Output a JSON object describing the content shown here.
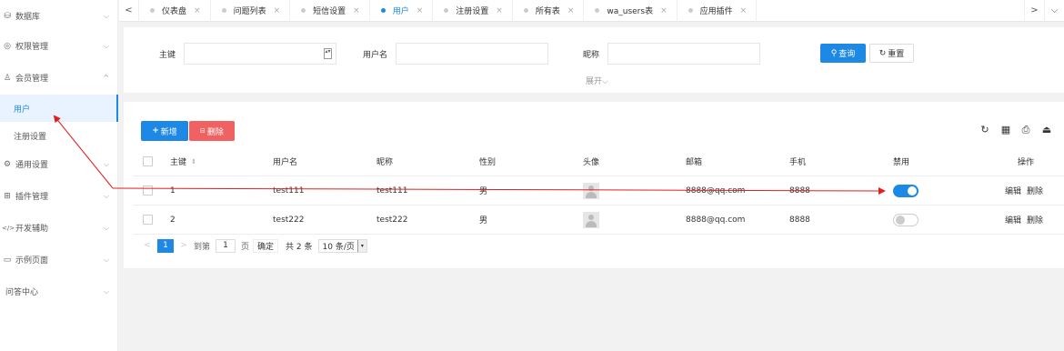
{
  "sidebar": {
    "items": [
      {
        "label": "数据库",
        "icon": "database-icon",
        "glyph": "⛁",
        "arrow": "⌵"
      },
      {
        "label": "权限管理",
        "icon": "shield-icon",
        "glyph": "◎",
        "arrow": "⌵"
      },
      {
        "label": "会员管理",
        "icon": "user-icon",
        "glyph": "♙",
        "arrow": "^"
      },
      {
        "label": "通用设置",
        "icon": "gear-icon",
        "glyph": "⚙",
        "arrow": "⌵"
      },
      {
        "label": "插件管理",
        "icon": "plugin-icon",
        "glyph": "⊞",
        "arrow": "⌵"
      },
      {
        "label": "开发辅助",
        "icon": "code-icon",
        "glyph": "</>",
        "arrow": "⌵"
      },
      {
        "label": "示例页面",
        "icon": "page-icon",
        "glyph": "▭",
        "arrow": "⌵"
      },
      {
        "label": "问答中心",
        "icon": "",
        "glyph": "",
        "arrow": "⌵"
      }
    ],
    "subitems": [
      "用户",
      "注册设置"
    ]
  },
  "tabs": [
    {
      "label": "仪表盘",
      "close": "×",
      "active": false
    },
    {
      "label": "问题列表",
      "close": "×",
      "active": false
    },
    {
      "label": "短信设置",
      "close": "×",
      "active": false
    },
    {
      "label": "用户",
      "close": "×",
      "active": true
    },
    {
      "label": "注册设置",
      "close": "×",
      "active": false
    },
    {
      "label": "所有表",
      "close": "×",
      "active": false
    },
    {
      "label": "wa_users表",
      "close": "×",
      "active": false
    },
    {
      "label": "应用插件",
      "close": "×",
      "active": false
    }
  ],
  "tab_nav": {
    "left": "<",
    "right": ">",
    "more": "⌵"
  },
  "search": {
    "pk_label": "主键",
    "pk_value": "",
    "spinner": "▴▾",
    "username_label": "用户名",
    "username_value": "",
    "nickname_label": "昵称",
    "nickname_value": "",
    "query_label": "查询",
    "query_icon": "⚲",
    "reset_label": "重置",
    "reset_icon": "↻",
    "expand_label": "展开",
    "expand_icon": "⌵"
  },
  "toolbar": {
    "add_label": "新增",
    "add_icon": "+",
    "delete_label": "删除",
    "delete_icon": "⊟",
    "tools": [
      {
        "name": "refresh-icon",
        "glyph": "↻"
      },
      {
        "name": "columns-icon",
        "glyph": "▦"
      },
      {
        "name": "print-icon",
        "glyph": "⎙"
      },
      {
        "name": "export-icon",
        "glyph": "⏏"
      }
    ]
  },
  "table": {
    "headers": [
      "主键",
      "用户名",
      "昵称",
      "性别",
      "头像",
      "邮箱",
      "手机",
      "禁用",
      "操作"
    ],
    "sort_icon": "⇕",
    "rows": [
      {
        "id": "1",
        "username": "test111",
        "nickname": "test111",
        "gender": "男",
        "email": "8888@qq.com",
        "phone": "8888",
        "disabled": true,
        "edit": "编辑",
        "delete": "删除"
      },
      {
        "id": "2",
        "username": "test222",
        "nickname": "test222",
        "gender": "男",
        "email": "8888@qq.com",
        "phone": "8888",
        "disabled": false,
        "edit": "编辑",
        "delete": "删除"
      }
    ]
  },
  "pagination": {
    "prev": "<",
    "next": ">",
    "current": "1",
    "goto_label": "到第",
    "goto_value": "1",
    "page_unit": "页",
    "confirm_label": "确定",
    "total_label": "共 2 条",
    "per_page": "10 条/页",
    "dropdown": "▾"
  },
  "colors": {
    "accent": "#1e88e5",
    "danger": "#f06262",
    "annotation": "#e02020"
  }
}
